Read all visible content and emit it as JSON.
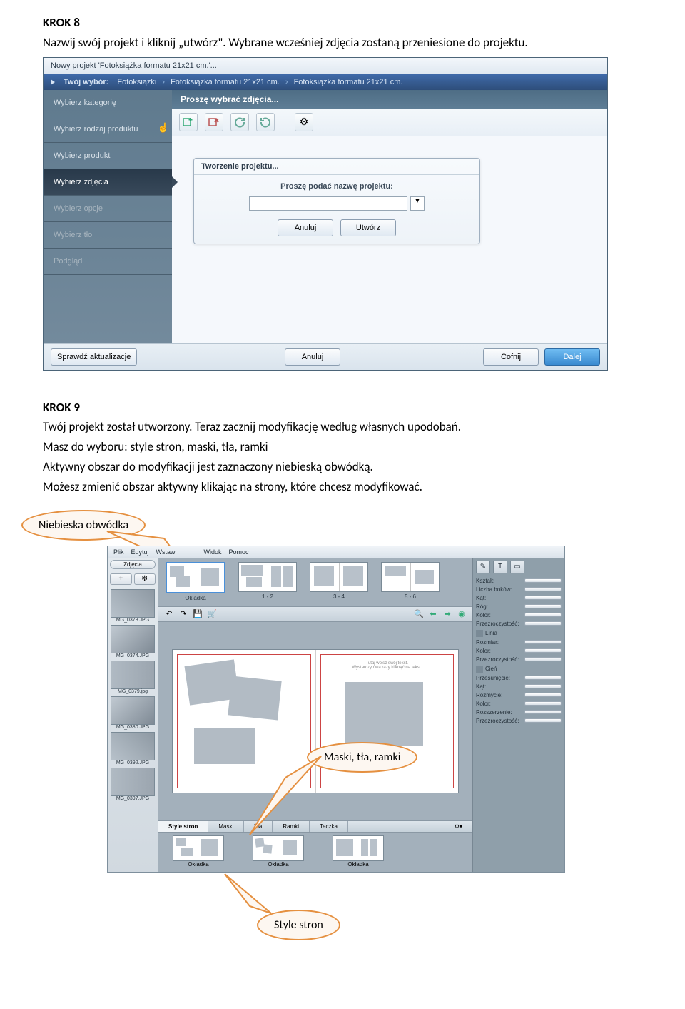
{
  "doc": {
    "step8_title": "KROK 8",
    "step8_text": "Nazwij swój projekt i kliknij „utwórz\". Wybrane wcześniej zdjęcia zostaną przeniesione do projektu.",
    "step9_title": "KROK 9",
    "step9_line1": "Twój projekt został utworzony. Teraz zacznij modyfikację według własnych upodobań.",
    "step9_line2": "Masz do wyboru: style stron, maski, tła, ramki",
    "step9_line3": "Aktywny obszar do modyfikacji jest zaznaczony niebieską obwódką.",
    "step9_line4": "Możesz zmienić obszar aktywny klikając na strony, które chcesz modyfikować.",
    "callout_blue": "Niebieska obwódka",
    "callout_masks": "Maski, tła, ramki",
    "callout_styles": "Style stron"
  },
  "app1": {
    "window_title": "Nowy projekt 'Fotoksiążka formatu 21x21 cm.'...",
    "bc_label": "Twój wybór:",
    "bc1": "Fotoksiążki",
    "bc2": "Fotoksiążka formatu 21x21 cm.",
    "bc3": "Fotoksiążka formatu 21x21 cm.",
    "side": {
      "s1": "Wybierz kategorię",
      "s2": "Wybierz rodzaj produktu",
      "s3": "Wybierz produkt",
      "s4": "Wybierz zdjęcia",
      "s5": "Wybierz opcje",
      "s6": "Wybierz tło",
      "s7": "Podgląd"
    },
    "main_header": "Proszę wybrać zdjęcia...",
    "dialog": {
      "title": "Tworzenie projektu...",
      "label": "Proszę podać nazwę projektu:",
      "cancel": "Anuluj",
      "create": "Utwórz"
    },
    "footer": {
      "updates": "Sprawdź aktualizacje",
      "cancel": "Anuluj",
      "back": "Cofnij",
      "next": "Dalej"
    }
  },
  "app2": {
    "menu": {
      "m1": "Plik",
      "m2": "Edytuj",
      "m3": "Wstaw",
      "m4": "Widok",
      "m5": "Pomoc"
    },
    "left_tab": "Zdjęcia",
    "plus": "+",
    "gear": "✻",
    "thumbs": [
      {
        "label": "MG_0373.JPG"
      },
      {
        "label": "MG_0374.JPG"
      },
      {
        "label": "MG_0379.jpg"
      },
      {
        "label": "MG_0380.JPG"
      },
      {
        "label": "MG_0392.JPG"
      },
      {
        "label": "MG_0397.JPG"
      }
    ],
    "spreads": [
      {
        "label": "Okładka"
      },
      {
        "label": "1 - 2"
      },
      {
        "label": "3 - 4"
      },
      {
        "label": "5 - 6"
      }
    ],
    "canvas_placeholder1": "Tutaj wpisz swój tekst.",
    "canvas_placeholder2": "Wystarczy dwa razy kliknąć na tekst.",
    "bottom_tabs": {
      "t1": "Style stron",
      "t2": "Maski",
      "t3": "Tła",
      "t4": "Ramki",
      "t5": "Teczka"
    },
    "bottom_labels": {
      "b1": "Okładka",
      "b2": "Okładka",
      "b3": "Okładka"
    },
    "rp_icons": {
      "i1": "✎",
      "i2": "T",
      "i3": "▭"
    },
    "rp": {
      "ksztalt": "Kształt:",
      "liczbabokow": "Liczba boków:",
      "kat": "Kąt:",
      "rog": "Róg:",
      "kolor": "Kolor:",
      "przezroczystosc": "Przezroczystość:",
      "linia": "Linia",
      "rozmiar": "Rozmiar:",
      "cien": "Cień",
      "przesuniecie": "Przesunięcie:",
      "rozmycie": "Rozmycie:",
      "rozszerzenie": "Rozszerzenie:"
    }
  }
}
